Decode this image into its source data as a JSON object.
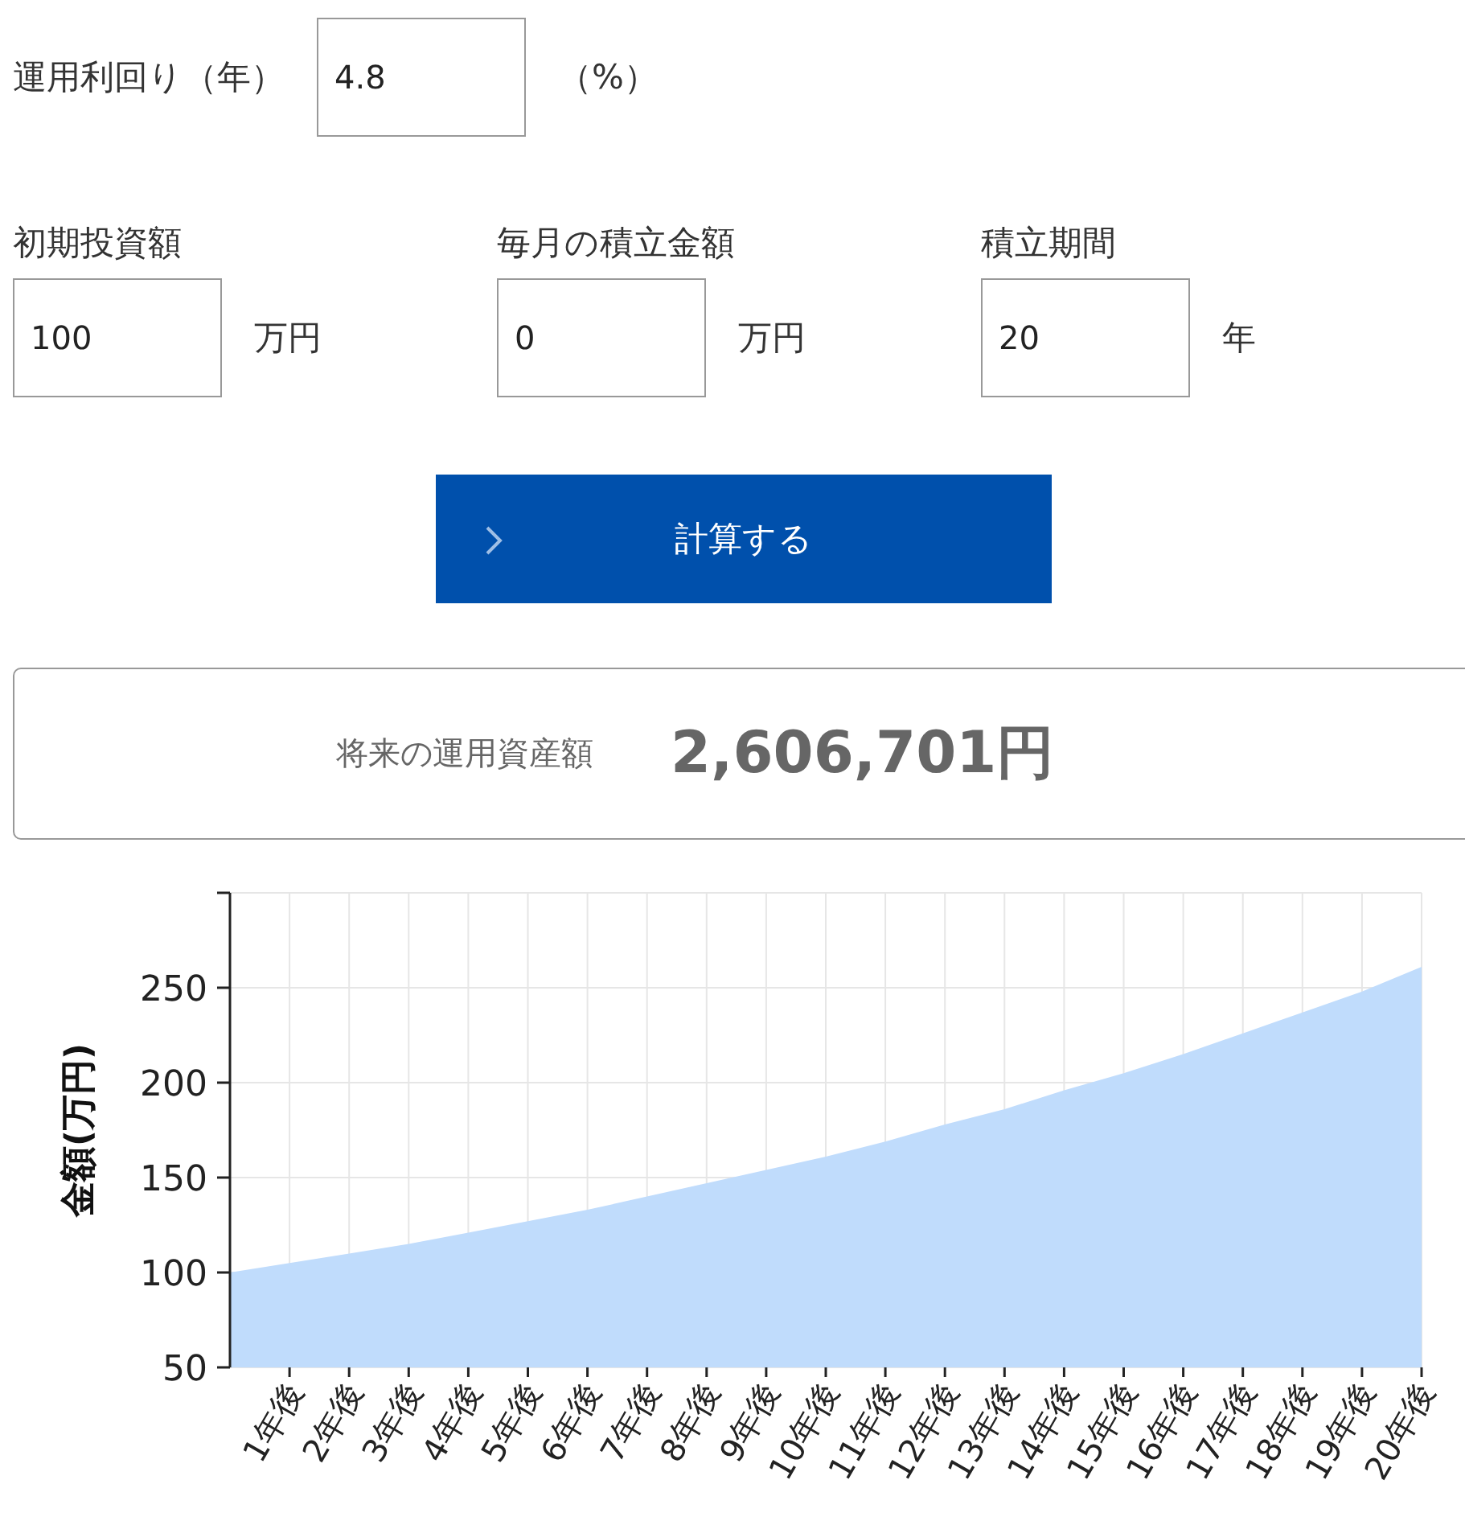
{
  "rate": {
    "label": "運用利回り（年）",
    "value": "4.8",
    "unit": "（%）"
  },
  "inputs": [
    {
      "label": "初期投資額",
      "value": "100",
      "unit": "万円"
    },
    {
      "label": "毎月の積立金額",
      "value": "0",
      "unit": "万円"
    },
    {
      "label": "積立期間",
      "value": "20",
      "unit": "年"
    }
  ],
  "button": {
    "label": "計算する"
  },
  "result": {
    "label": "将来の運用資産額",
    "amount": "2,606,701円"
  },
  "chart_data": {
    "type": "area",
    "ylabel": "金額(万円)",
    "x": [
      0,
      1,
      2,
      3,
      4,
      5,
      6,
      7,
      8,
      9,
      10,
      11,
      12,
      13,
      14,
      15,
      16,
      17,
      18,
      19,
      20
    ],
    "series": [
      {
        "color": "#c0dcfc",
        "values": [
          100,
          105,
          110,
          115,
          121,
          127,
          133,
          140,
          147,
          154,
          161,
          169,
          178,
          186,
          196,
          205,
          215,
          226,
          237,
          248,
          261
        ]
      }
    ],
    "grid": true,
    "xlim": [
      0,
      20
    ],
    "ylim": [
      50,
      300
    ],
    "xticks": [
      {
        "value": 1,
        "label": "1年後"
      },
      {
        "value": 2,
        "label": "2年後"
      },
      {
        "value": 3,
        "label": "3年後"
      },
      {
        "value": 4,
        "label": "4年後"
      },
      {
        "value": 5,
        "label": "5年後"
      },
      {
        "value": 6,
        "label": "6年後"
      },
      {
        "value": 7,
        "label": "7年後"
      },
      {
        "value": 8,
        "label": "8年後"
      },
      {
        "value": 9,
        "label": "9年後"
      },
      {
        "value": 10,
        "label": "10年後"
      },
      {
        "value": 11,
        "label": "11年後"
      },
      {
        "value": 12,
        "label": "12年後"
      },
      {
        "value": 13,
        "label": "13年後"
      },
      {
        "value": 14,
        "label": "14年後"
      },
      {
        "value": 15,
        "label": "15年後"
      },
      {
        "value": 16,
        "label": "16年後"
      },
      {
        "value": 17,
        "label": "17年後"
      },
      {
        "value": 18,
        "label": "18年後"
      },
      {
        "value": 19,
        "label": "19年後"
      },
      {
        "value": 20,
        "label": "20年後"
      }
    ],
    "yticks": [
      50,
      100,
      150,
      200,
      250
    ]
  }
}
